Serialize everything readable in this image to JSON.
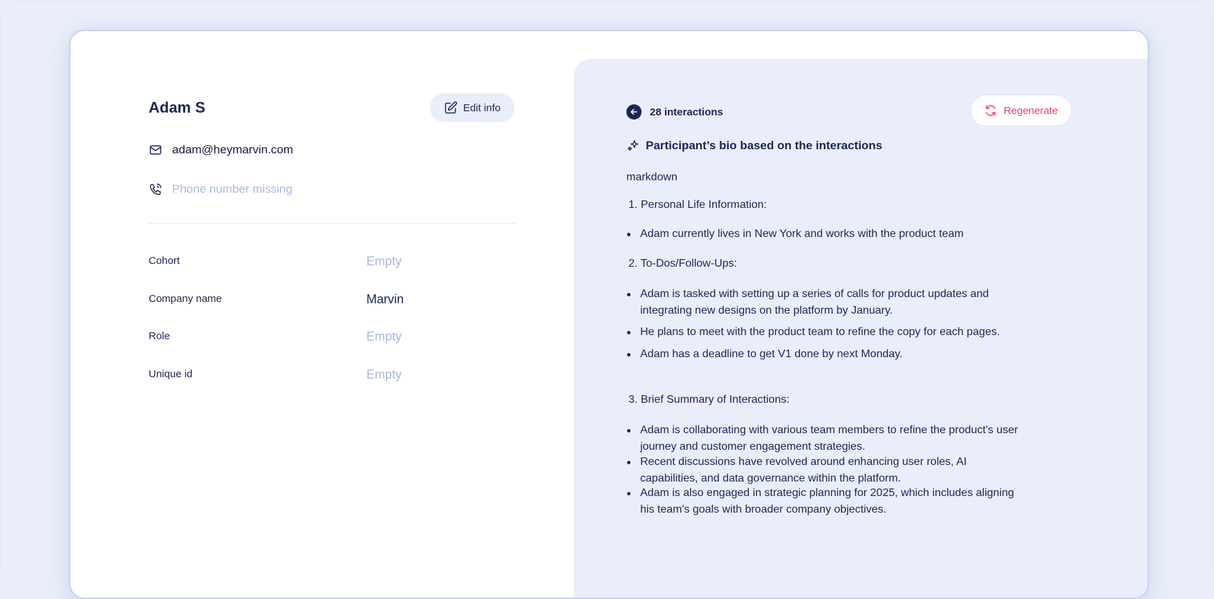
{
  "profile": {
    "name": "Adam S",
    "edit_label": "Edit info",
    "email": "adam@heymarvin.com",
    "phone_placeholder": "Phone number missing",
    "fields": [
      {
        "label": "Cohort",
        "value": "Empty",
        "empty": true
      },
      {
        "label": "Company name",
        "value": "Marvin",
        "empty": false
      },
      {
        "label": "Role",
        "value": "Empty",
        "empty": true
      },
      {
        "label": "Unique id",
        "value": "Empty",
        "empty": true
      }
    ]
  },
  "bio": {
    "interactions_label": "28 interactions",
    "regenerate_label": "Regenerate",
    "title": "Participant’s bio based on the interactions",
    "format_word": "markdown",
    "section1_heading": "1.  Personal Life Information:",
    "section1_bullets": [
      "Adam currently lives in New York and works with the product team"
    ],
    "section2_heading": "2.  To-Dos/Follow-Ups:",
    "section2_bullets": [
      "Adam is tasked with setting up a series of calls for product updates and integrating new designs on the platform by January.",
      "He plans to meet with the product team to refine the copy for each pages.",
      "Adam has a deadline to get V1 done by next Monday."
    ],
    "section3_heading": "3. Brief Summary of Interactions:",
    "section3_bullets": [
      "Adam is collaborating with various team members to refine the product's user journey and customer engagement strategies.",
      "Recent discussions have revolved around enhancing user roles, AI capabilities, and data governance within the platform.",
      "Adam is also engaged in strategic planning for 2025, which includes aligning his team's goals with broader company objectives."
    ]
  },
  "colors": {
    "background": "#e9eefa",
    "primary_text": "#1c2554",
    "muted_text": "#a9b8e3",
    "accent_red": "#e5416c"
  },
  "icons": [
    "pencil-square-icon",
    "envelope-icon",
    "phone-icon",
    "arrow-left-circle-icon",
    "refresh-icon",
    "sparkles-icon"
  ]
}
